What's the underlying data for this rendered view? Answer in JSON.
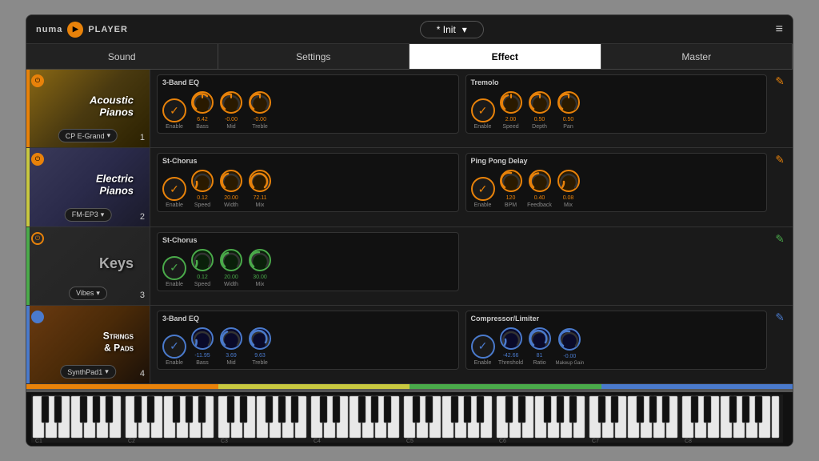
{
  "header": {
    "logo_text": "numa",
    "player_text": "PLAYER",
    "preset": "* Init",
    "menu_icon": "≡"
  },
  "nav": {
    "tabs": [
      "Sound",
      "Settings",
      "Effect",
      "Master"
    ],
    "active": "Effect"
  },
  "instruments": [
    {
      "id": 1,
      "name": "Acoustic\nPianos",
      "style": "italic",
      "preset": "CP E-Grand",
      "number": "1",
      "power": true,
      "color": "#e8820a",
      "active": true
    },
    {
      "id": 2,
      "name": "Electric\nPianos",
      "style": "italic",
      "preset": "FM-EP3",
      "number": "2",
      "power": true,
      "color": "#c8c840",
      "active": true
    },
    {
      "id": 3,
      "name": "Keys",
      "style": "normal",
      "preset": "Vibes",
      "number": "3",
      "power": false,
      "color": "#4aaa4a",
      "active": false
    },
    {
      "id": 4,
      "name": "Strings\n& Pads",
      "style": "caps",
      "preset": "SynthPad1",
      "number": "4",
      "power": true,
      "color": "#4a7acc",
      "active": true
    }
  ],
  "effects": [
    {
      "row": 1,
      "left": {
        "title": "3-Band EQ",
        "enable": {
          "value": true,
          "type": "orange"
        },
        "knobs": [
          {
            "label": "Enable",
            "value": "",
            "type": "enable"
          },
          {
            "label": "Bass",
            "value": "6.42",
            "type": "orange"
          },
          {
            "label": "Mid",
            "value": "-0.00",
            "type": "orange"
          },
          {
            "label": "Treble",
            "value": "-0.00",
            "type": "orange"
          }
        ]
      },
      "right": {
        "title": "Tremolo",
        "enable": {
          "value": true,
          "type": "orange"
        },
        "knobs": [
          {
            "label": "Enable",
            "value": "",
            "type": "enable"
          },
          {
            "label": "Speed",
            "value": "2.00",
            "type": "orange"
          },
          {
            "label": "Depth",
            "value": "0.50",
            "type": "orange"
          },
          {
            "label": "Pan",
            "value": "0.50",
            "type": "orange"
          }
        ]
      },
      "pencil_color": "orange"
    },
    {
      "row": 2,
      "left": {
        "title": "St-Chorus",
        "enable": {
          "value": true,
          "type": "orange"
        },
        "knobs": [
          {
            "label": "Enable",
            "value": "",
            "type": "enable"
          },
          {
            "label": "Speed",
            "value": "0.12",
            "type": "orange"
          },
          {
            "label": "Width",
            "value": "20.00",
            "type": "orange"
          },
          {
            "label": "Mix",
            "value": "72.11",
            "type": "orange"
          }
        ]
      },
      "right": {
        "title": "Ping Pong Delay",
        "enable": {
          "value": true,
          "type": "orange"
        },
        "knobs": [
          {
            "label": "Enable",
            "value": "",
            "type": "enable"
          },
          {
            "label": "BPM",
            "value": "120",
            "type": "orange"
          },
          {
            "label": "Feedback",
            "value": "0.40",
            "type": "orange"
          },
          {
            "label": "Mix",
            "value": "0.08",
            "type": "orange"
          }
        ]
      },
      "pencil_color": "orange"
    },
    {
      "row": 3,
      "left": {
        "title": "St-Chorus",
        "enable": {
          "value": true,
          "type": "green"
        },
        "knobs": [
          {
            "label": "Enable",
            "value": "",
            "type": "enable-green"
          },
          {
            "label": "Speed",
            "value": "0.12",
            "type": "green"
          },
          {
            "label": "Width",
            "value": "20.00",
            "type": "green"
          },
          {
            "label": "Mix",
            "value": "30.00",
            "type": "green"
          }
        ]
      },
      "right": null,
      "pencil_color": "green"
    },
    {
      "row": 4,
      "left": {
        "title": "3-Band EQ",
        "enable": {
          "value": true,
          "type": "blue"
        },
        "knobs": [
          {
            "label": "Enable",
            "value": "",
            "type": "enable-blue"
          },
          {
            "label": "Bass",
            "value": "-11.95",
            "type": "blue"
          },
          {
            "label": "Mid",
            "value": "3.69",
            "type": "blue"
          },
          {
            "label": "Treble",
            "value": "9.63",
            "type": "blue"
          }
        ]
      },
      "right": {
        "title": "Compressor/Limiter",
        "enable": {
          "value": true,
          "type": "blue"
        },
        "knobs": [
          {
            "label": "Enable",
            "value": "",
            "type": "enable-blue"
          },
          {
            "label": "Threshold",
            "value": "-42.66",
            "type": "blue"
          },
          {
            "label": "Ratio",
            "value": "81",
            "type": "blue"
          },
          {
            "label": "Makeup Gain",
            "value": "-0.00",
            "type": "blue"
          }
        ]
      },
      "pencil_color": "blue"
    }
  ],
  "piano": {
    "octaves": [
      "C1",
      "C2",
      "C3",
      "C4",
      "C5",
      "C6",
      "C7",
      "C8"
    ],
    "color_bars": [
      "#e8820a",
      "#c8c840",
      "#4aaa4a",
      "#4a7acc"
    ]
  }
}
